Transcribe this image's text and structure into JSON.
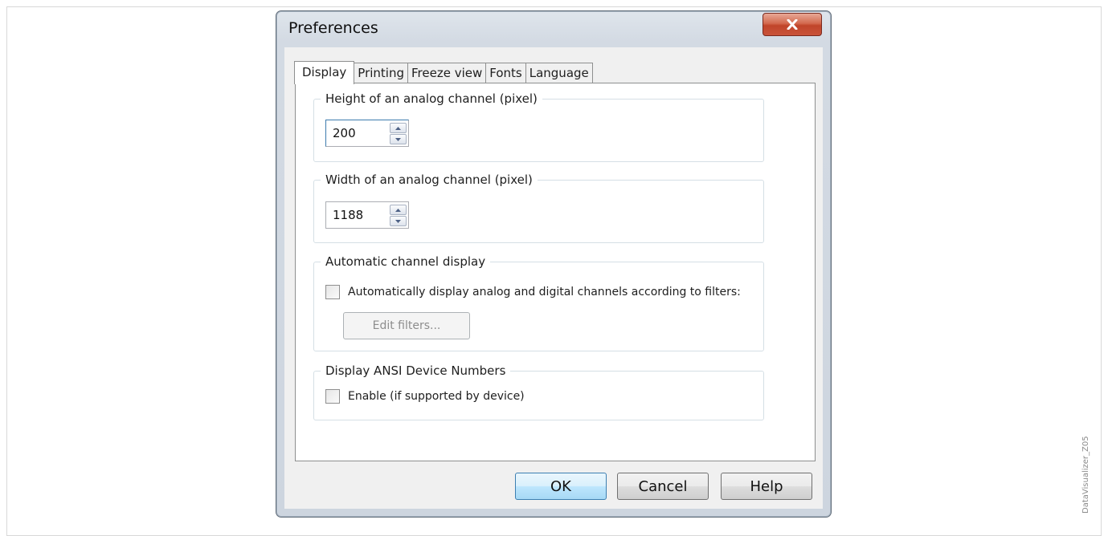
{
  "side_label": "DataVisualizer_Z05",
  "window": {
    "title": "Preferences",
    "close_icon": "close-icon"
  },
  "tabs": [
    {
      "label": "Display",
      "active": true
    },
    {
      "label": "Printing",
      "active": false
    },
    {
      "label": "Freeze view",
      "active": false
    },
    {
      "label": "Fonts",
      "active": false
    },
    {
      "label": "Language",
      "active": false
    }
  ],
  "display_tab": {
    "height_group": {
      "legend": "Height of an analog channel (pixel)",
      "value": "200"
    },
    "width_group": {
      "legend": "Width of an analog channel (pixel)",
      "value": "1188"
    },
    "auto_group": {
      "legend": "Automatic channel display",
      "checkbox_label": "Automatically display analog and digital channels according to filters:",
      "checked": false,
      "edit_filters_label": "Edit filters..."
    },
    "ansi_group": {
      "legend": "Display ANSI Device Numbers",
      "checkbox_label": "Enable (if supported by device)",
      "checked": false
    }
  },
  "buttons": {
    "ok": "OK",
    "cancel": "Cancel",
    "help": "Help"
  },
  "colors": {
    "close_button": "#c9533a",
    "default_button_border": "#3c7fb1",
    "window_frame": "#cdd5df"
  }
}
